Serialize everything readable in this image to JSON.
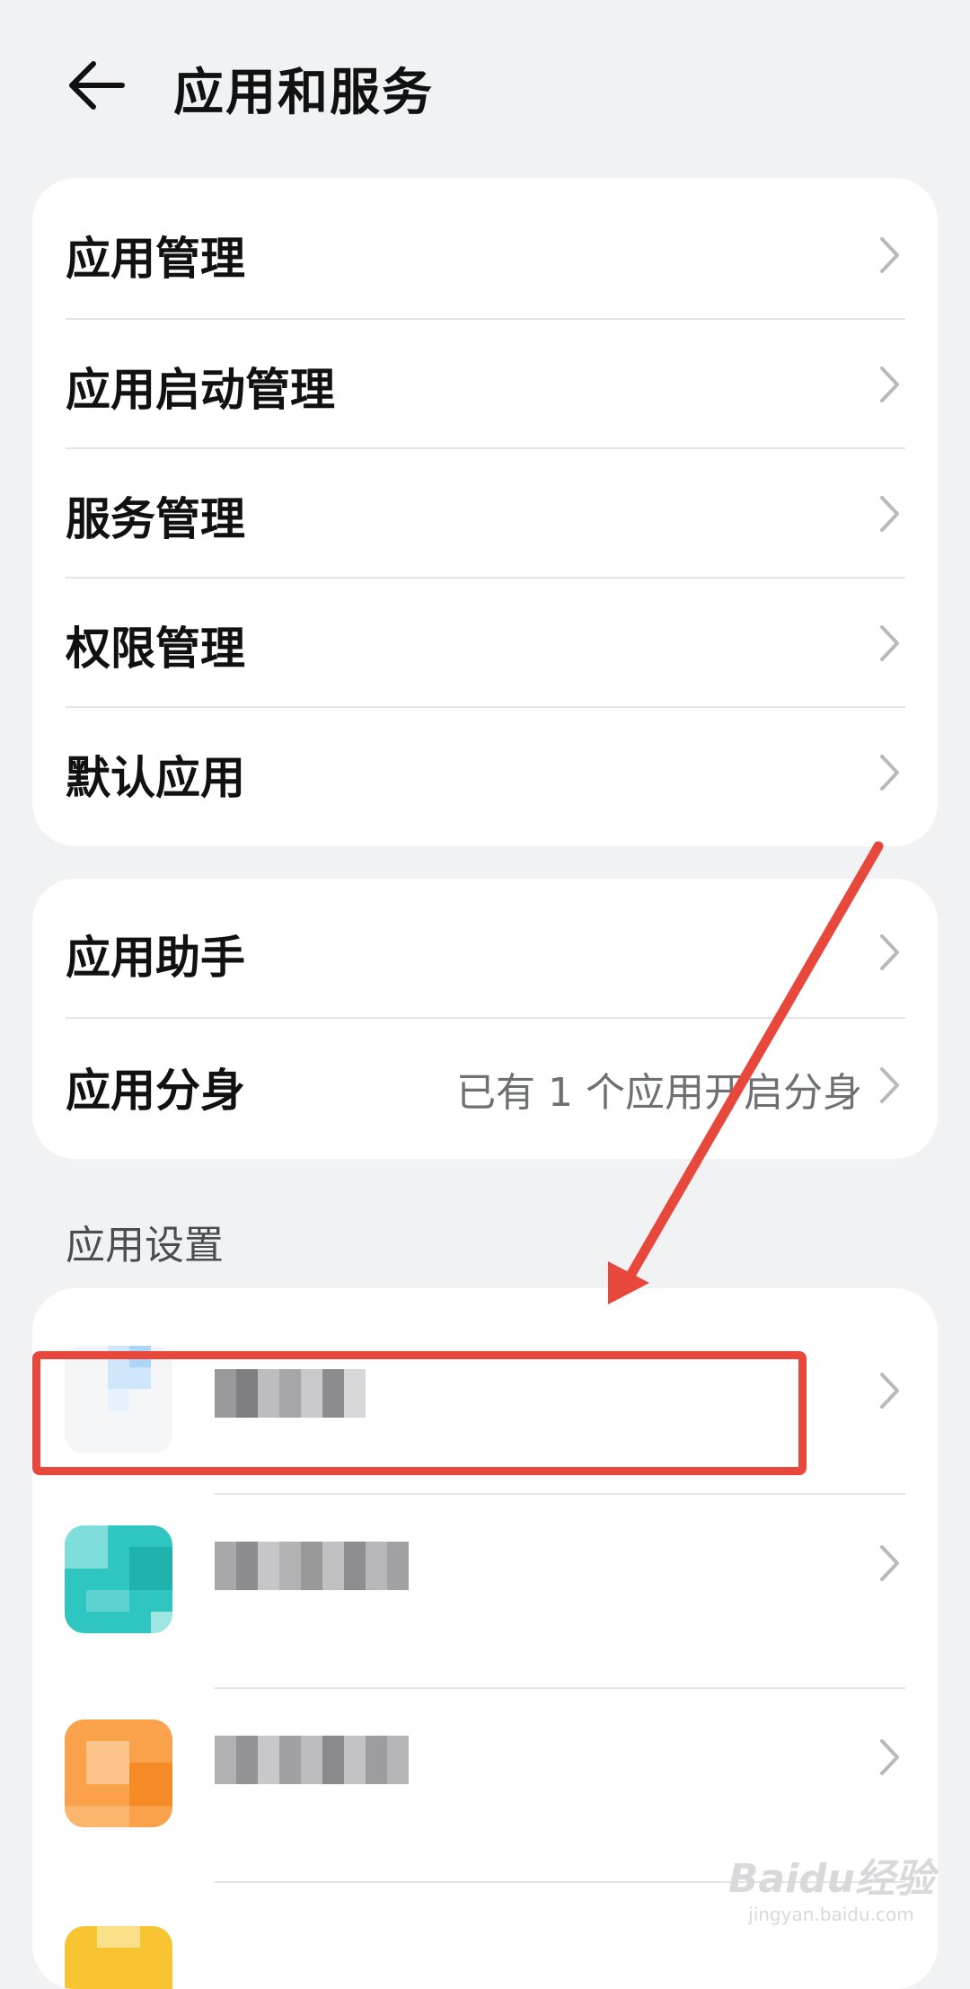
{
  "header": {
    "title": "应用和服务",
    "back_icon": "arrow-left-icon"
  },
  "group1": {
    "items": [
      {
        "label": "应用管理"
      },
      {
        "label": "应用启动管理"
      },
      {
        "label": "服务管理"
      },
      {
        "label": "权限管理"
      },
      {
        "label": "默认应用"
      }
    ]
  },
  "group2": {
    "items": [
      {
        "label": "应用助手",
        "value": ""
      },
      {
        "label": "应用分身",
        "value": "已有 1 个应用开启分身"
      }
    ]
  },
  "app_settings": {
    "section_title": "应用设置",
    "apps": [
      {
        "icon_color": "#dbeefc",
        "highlighted": true
      },
      {
        "icon_color": "#2fc6c1",
        "highlighted": false
      },
      {
        "icon_color": "#f9a24b",
        "highlighted": false
      },
      {
        "icon_color": "#f7c531",
        "highlighted": false
      }
    ]
  },
  "annotation": {
    "arrow_color": "#e8483b",
    "box_color": "#e8483b"
  },
  "watermark": {
    "line1": "Baidu经验",
    "line2": "jingyan.baidu.com"
  }
}
